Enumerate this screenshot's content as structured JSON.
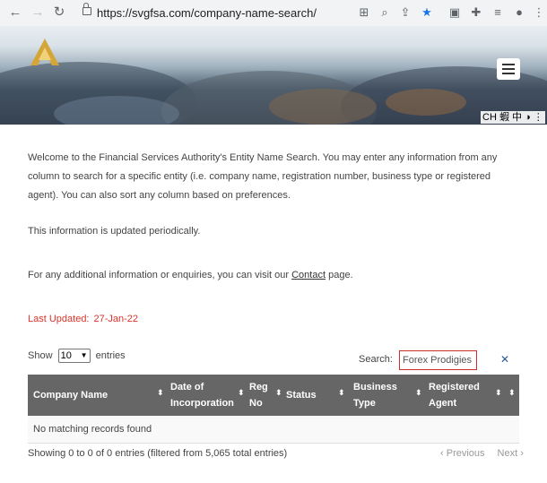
{
  "browser": {
    "url": "https://svgfsa.com/company-name-search/"
  },
  "ime": {
    "label": "CH 蝦 中 ◑ ⋮"
  },
  "intro": {
    "paragraph1": "Welcome to the Financial Services Authority's Entity Name Search. You may enter any information from any column to search for a specific entity (i.e. company name, registration number, business type or registered agent). You can also sort any column based on preferences.",
    "paragraph2": "This information is updated periodically.",
    "paragraph3_before": "For any additional information or enquiries, you can visit our ",
    "paragraph3_link": "Contact",
    "paragraph3_after": " page."
  },
  "last_updated": {
    "label": "Last Updated:",
    "value": "27-Jan-22"
  },
  "controls": {
    "show_label": "Show",
    "entries_value": "10",
    "entries_label": "entries",
    "search_label": "Search:",
    "search_value": "Forex Prodigies",
    "clear_icon": "✕"
  },
  "table": {
    "columns": [
      "Company Name",
      "Date of Incorporation",
      "Reg No",
      "Status",
      "Business Type",
      "Registered Agent"
    ],
    "empty_message": "No matching records found"
  },
  "footer": {
    "info": "Showing 0 to 0 of 0 entries (filtered from 5,065 total entries)",
    "previous": "Previous",
    "next": "Next"
  },
  "colors": {
    "table_header": "#666666",
    "accent_red": "#d9342b",
    "search_border": "#c9302c",
    "chrome_bg": "#f1f3f4"
  }
}
